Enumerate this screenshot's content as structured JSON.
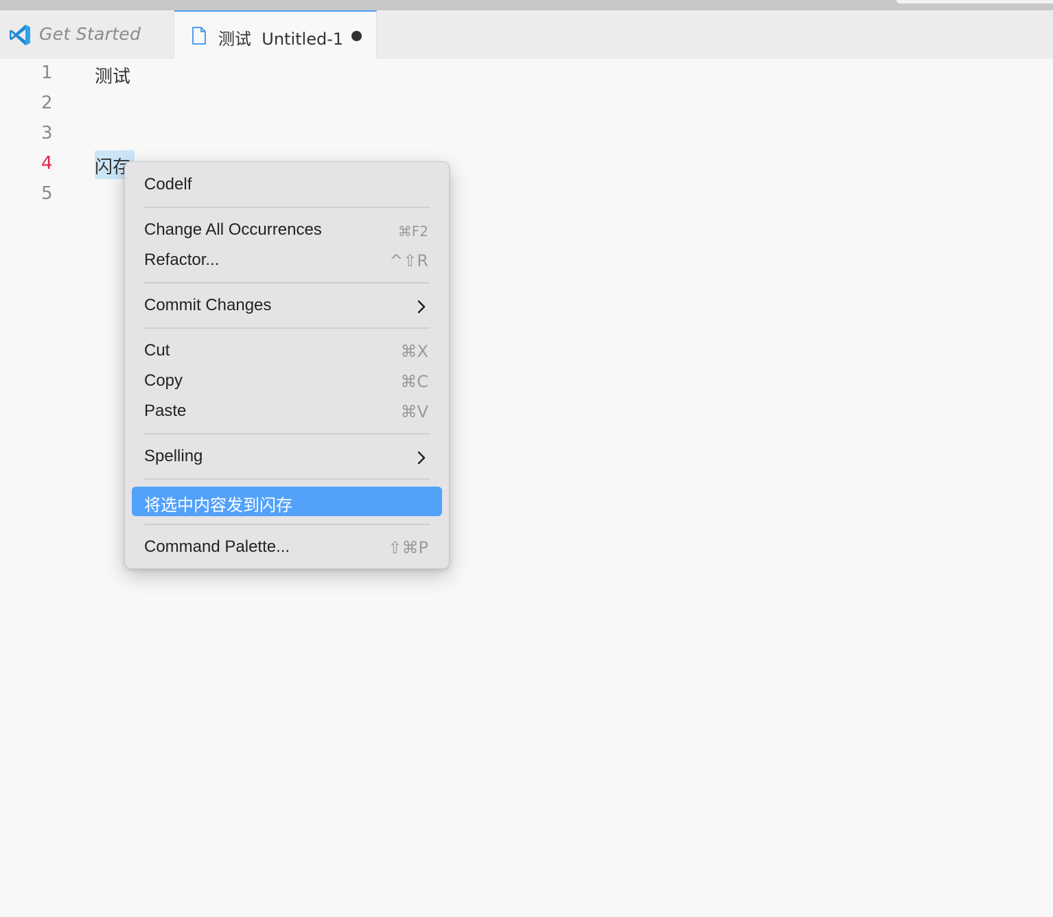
{
  "tabs": [
    {
      "label": "Get Started",
      "icon": "vscode-logo-icon"
    },
    {
      "label": "测试  Untitled-1",
      "icon": "file-icon",
      "dirty": true
    }
  ],
  "editor": {
    "line_numbers": [
      "1",
      "2",
      "3",
      "4",
      "5"
    ],
    "lines": [
      "测试",
      "",
      "",
      "闪存",
      ""
    ],
    "active_line": "4"
  },
  "context_menu": {
    "codelf": "Codelf",
    "change_all": {
      "label": "Change All Occurrences",
      "shortcut": "⌘F2"
    },
    "refactor": {
      "label": "Refactor...",
      "shortcut": "^⇧R"
    },
    "commit_changes": {
      "label": "Commit Changes"
    },
    "cut": {
      "label": "Cut",
      "shortcut": "⌘X"
    },
    "copy": {
      "label": "Copy",
      "shortcut": "⌘C"
    },
    "paste": {
      "label": "Paste",
      "shortcut": "⌘V"
    },
    "spelling": {
      "label": "Spelling"
    },
    "send_to_flash": {
      "label": "将选中内容发到闪存"
    },
    "command_palette": {
      "label": "Command Palette...",
      "shortcut": "⇧⌘P"
    }
  },
  "colors": {
    "accent": "#52a1fa",
    "active_line_number": "#e0284d",
    "selection": "#cde6f7"
  }
}
